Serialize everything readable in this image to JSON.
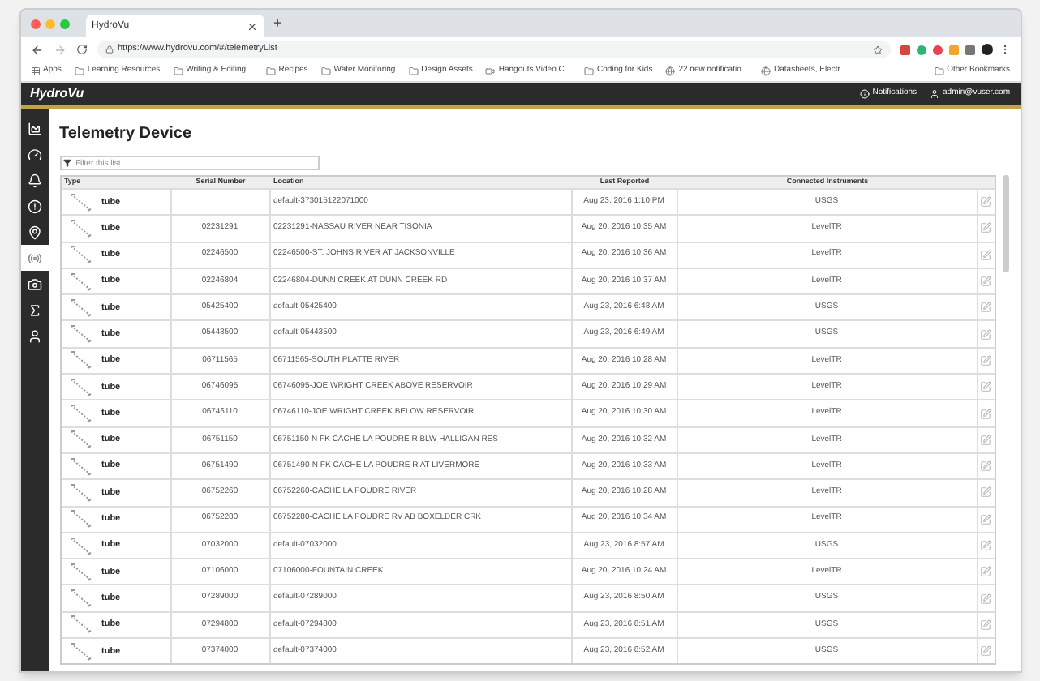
{
  "browser": {
    "tab_title": "HydroVu",
    "new_tab": "+",
    "url": "https://www.hydrovu.com/#/telemetryList",
    "bookmarks": [
      {
        "label": "Apps",
        "kind": "apps"
      },
      {
        "label": "Learning Resources",
        "kind": "folder"
      },
      {
        "label": "Writing & Editing...",
        "kind": "folder"
      },
      {
        "label": "Recipes",
        "kind": "folder"
      },
      {
        "label": "Water Monitoring",
        "kind": "folder"
      },
      {
        "label": "Design Assets",
        "kind": "folder"
      },
      {
        "label": "Hangouts Video C...",
        "kind": "hangouts"
      },
      {
        "label": "Coding for Kids",
        "kind": "folder"
      },
      {
        "label": "22 new notificatio...",
        "kind": "site"
      },
      {
        "label": "Datasheets, Electr...",
        "kind": "site"
      }
    ],
    "other_bookmarks": "Other Bookmarks"
  },
  "app": {
    "logo": "HydroVu",
    "notifications": "Notifications",
    "user": "admin@vuser.com"
  },
  "sidebar": [
    {
      "kind": "chart",
      "selected": false
    },
    {
      "kind": "gauge",
      "selected": false
    },
    {
      "kind": "bell",
      "selected": false
    },
    {
      "kind": "alert",
      "selected": false
    },
    {
      "kind": "pin",
      "selected": false
    },
    {
      "kind": "signal",
      "selected": true
    },
    {
      "kind": "camera",
      "selected": false
    },
    {
      "kind": "sigma",
      "selected": false
    },
    {
      "kind": "user",
      "selected": false
    }
  ],
  "page": {
    "title": "Telemetry Device",
    "filter": {
      "placeholder": "Filter this list"
    }
  },
  "table": {
    "columns": [
      "Type",
      "Serial Number",
      "Location",
      "Last Reported",
      "Connected Instruments"
    ],
    "rows": [
      {
        "type": "tube",
        "serial": "",
        "location": "default-373015122071000",
        "last_reported": "Aug 23, 2016 1:10 PM",
        "instruments": "USGS"
      },
      {
        "type": "tube",
        "serial": "02231291",
        "location": "02231291-NASSAU RIVER NEAR TISONIA",
        "last_reported": "Aug 20, 2016 10:35 AM",
        "instruments": "LevelTR"
      },
      {
        "type": "tube",
        "serial": "02246500",
        "location": "02246500-ST. JOHNS RIVER AT JACKSONVILLE",
        "last_reported": "Aug 20, 2016 10:36 AM",
        "instruments": "LevelTR"
      },
      {
        "type": "tube",
        "serial": "02246804",
        "location": "02246804-DUNN CREEK AT DUNN CREEK RD",
        "last_reported": "Aug 20, 2016 10:37 AM",
        "instruments": "LevelTR"
      },
      {
        "type": "tube",
        "serial": "05425400",
        "location": "default-05425400",
        "last_reported": "Aug 23, 2016 6:48 AM",
        "instruments": "USGS"
      },
      {
        "type": "tube",
        "serial": "05443500",
        "location": "default-05443500",
        "last_reported": "Aug 23, 2016 6:49 AM",
        "instruments": "USGS"
      },
      {
        "type": "tube",
        "serial": "06711565",
        "location": "06711565-SOUTH PLATTE RIVER",
        "last_reported": "Aug 20, 2016 10:28 AM",
        "instruments": "LevelTR"
      },
      {
        "type": "tube",
        "serial": "06746095",
        "location": "06746095-JOE WRIGHT CREEK ABOVE RESERVOIR",
        "last_reported": "Aug 20, 2016 10:29 AM",
        "instruments": "LevelTR"
      },
      {
        "type": "tube",
        "serial": "06746110",
        "location": "06746110-JOE WRIGHT CREEK BELOW RESERVOIR",
        "last_reported": "Aug 20, 2016 10:30 AM",
        "instruments": "LevelTR"
      },
      {
        "type": "tube",
        "serial": "06751150",
        "location": "06751150-N FK CACHE LA POUDRE R BLW HALLIGAN RES",
        "last_reported": "Aug 20, 2016 10:32 AM",
        "instruments": "LevelTR"
      },
      {
        "type": "tube",
        "serial": "06751490",
        "location": "06751490-N FK CACHE LA POUDRE R AT LIVERMORE",
        "last_reported": "Aug 20, 2016 10:33 AM",
        "instruments": "LevelTR"
      },
      {
        "type": "tube",
        "serial": "06752260",
        "location": "06752260-CACHE LA POUDRE RIVER",
        "last_reported": "Aug 20, 2016 10:28 AM",
        "instruments": "LevelTR"
      },
      {
        "type": "tube",
        "serial": "06752280",
        "location": "06752280-CACHE LA POUDRE RV AB BOXELDER CRK",
        "last_reported": "Aug 20, 2016 10:34 AM",
        "instruments": "LevelTR"
      },
      {
        "type": "tube",
        "serial": "07032000",
        "location": "default-07032000",
        "last_reported": "Aug 23, 2016 8:57 AM",
        "instruments": "USGS"
      },
      {
        "type": "tube",
        "serial": "07106000",
        "location": "07106000-FOUNTAIN CREEK",
        "last_reported": "Aug 20, 2016 10:24 AM",
        "instruments": "LevelTR"
      },
      {
        "type": "tube",
        "serial": "07289000",
        "location": "default-07289000",
        "last_reported": "Aug 23, 2016 8:50 AM",
        "instruments": "USGS"
      },
      {
        "type": "tube",
        "serial": "07294800",
        "location": "default-07294800",
        "last_reported": "Aug 23, 2016 8:51 AM",
        "instruments": "USGS"
      },
      {
        "type": "tube",
        "serial": "07374000",
        "location": "default-07374000",
        "last_reported": "Aug 23, 2016 8:52 AM",
        "instruments": "USGS"
      }
    ]
  }
}
